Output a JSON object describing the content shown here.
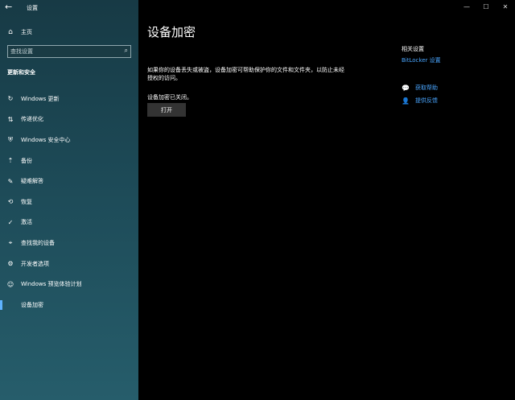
{
  "window": {
    "title": "设置",
    "controls": [
      "—",
      "☐",
      "✕"
    ]
  },
  "sidebar": {
    "back_icon": "←",
    "home_icon": "⌂",
    "home_label": "主页",
    "search_placeholder": "查找设置",
    "search_icon": "⌕",
    "section_title": "更新和安全",
    "items": [
      {
        "icon": "↻",
        "label": "Windows 更新"
      },
      {
        "icon": "⇅",
        "label": "传递优化"
      },
      {
        "icon": "⛨",
        "label": "Windows 安全中心"
      },
      {
        "icon": "⇡",
        "label": "备份"
      },
      {
        "icon": "✎",
        "label": "疑难解答"
      },
      {
        "icon": "⟲",
        "label": "恢复"
      },
      {
        "icon": "✓",
        "label": "激活"
      },
      {
        "icon": "⌖",
        "label": "查找我的设备"
      },
      {
        "icon": "⚙",
        "label": "开发者选项"
      },
      {
        "icon": "☺",
        "label": "Windows 预览体验计划"
      },
      {
        "icon": "",
        "label": "设备加密"
      }
    ],
    "active_index": 10
  },
  "main": {
    "title": "设备加密",
    "description": "如果你的设备丢失或被盗，设备加密可帮助保护你的文件和文件夹，以防止未经授权的访问。",
    "status": "设备加密已关闭。",
    "button_label": "打开"
  },
  "related": {
    "title": "相关设置",
    "bitlocker_link": "BitLocker 设置",
    "help_icon": "💬",
    "help_label": "获取帮助",
    "feedback_icon": "👤",
    "feedback_label": "提供反馈"
  }
}
